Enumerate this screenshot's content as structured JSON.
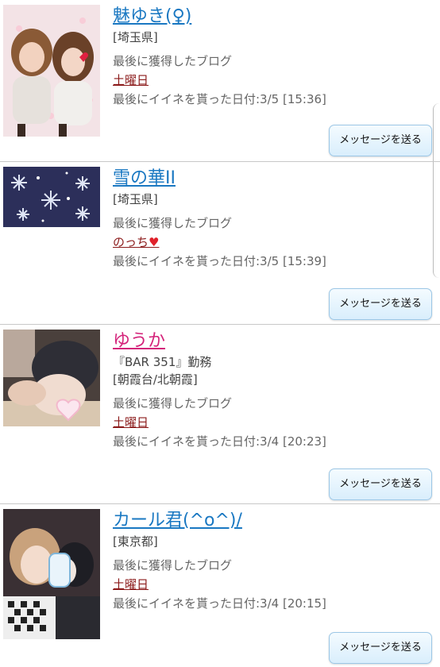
{
  "entries": [
    {
      "name": "魅ゆき(♀)",
      "name_color": "#1a78c2",
      "extra": "",
      "location": "[埼玉県]",
      "blog_label": "最後に獲得したブログ",
      "blog_title": "土曜日",
      "blog_heart": "",
      "liked_label": "最後にイイネを貰った日付:3/5 [15:36]",
      "button": "メッセージを送る"
    },
    {
      "name": "雪の華II",
      "name_color": "#1a78c2",
      "extra": "",
      "location": "[埼玉県]",
      "blog_label": "最後に獲得したブログ",
      "blog_title": "のっち",
      "blog_heart": "♥",
      "liked_label": "最後にイイネを貰った日付:3/5 [15:39]",
      "button": "メッセージを送る"
    },
    {
      "name": "ゆうか",
      "name_color": "#d4237a",
      "extra": "『BAR 351』勤務",
      "location": "[朝霞台/北朝霞]",
      "blog_label": "最後に獲得したブログ",
      "blog_title": "土曜日",
      "blog_heart": "",
      "liked_label": "最後にイイネを貰った日付:3/4 [20:23]",
      "button": "メッセージを送る"
    },
    {
      "name": "カール君(^o^)/",
      "name_color": "#1a78c2",
      "extra": "",
      "location": "[東京都]",
      "blog_label": "最後に獲得したブログ",
      "blog_title": "土曜日",
      "blog_heart": "",
      "liked_label": "最後にイイネを貰った日付:3/4 [20:15]",
      "button": "メッセージを送る"
    }
  ]
}
